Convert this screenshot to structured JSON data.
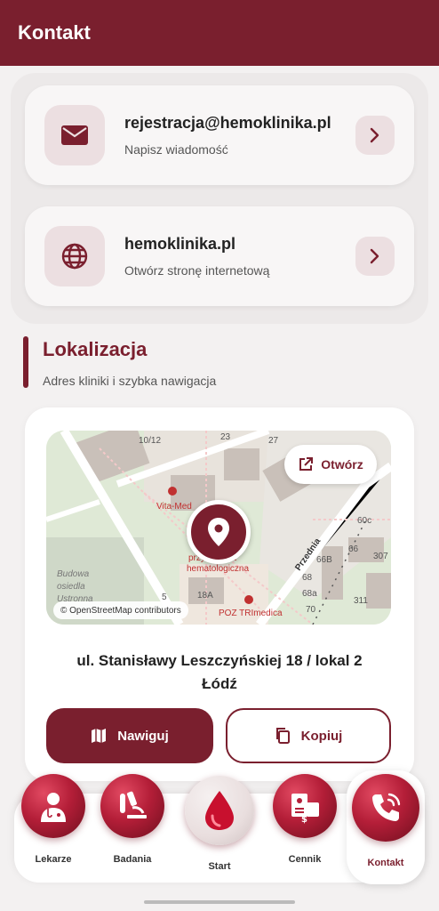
{
  "appbar": {
    "title": "Kontakt"
  },
  "contacts": [
    {
      "title": "rejestracja@hemoklinika.pl",
      "subtitle": "Napisz wiadomość",
      "icon": "mail-icon"
    },
    {
      "title": "hemoklinika.pl",
      "subtitle": "Otwórz stronę internetową",
      "icon": "globe-icon"
    }
  ],
  "section": {
    "title": "Lokalizacja",
    "subtitle": "Adres kliniki i szybka nawigacja"
  },
  "map": {
    "open_label": "Otwórz",
    "attribution": "© OpenStreetMap contributors",
    "labels": {
      "l1": "10/12",
      "l2": "23",
      "l3": "27",
      "vita": "Vita-Med",
      "przych1": "przychodnia",
      "przych2": "hematologiczna",
      "budowa1": "Budowa",
      "budowa2": "osiedla",
      "budowa3": "Ustronna",
      "l18a": "18A",
      "poz": "POZ TRImedica",
      "przednia": "Przednia",
      "l60c": "60c",
      "l66": "66",
      "l66b": "66B",
      "l68": "68",
      "l68a": "68a",
      "l70": "70",
      "l307": "307",
      "l311": "311",
      "l5": "5"
    }
  },
  "address": {
    "line1": "ul. Stanisławy Leszczyńskiej 18 / lokal 2",
    "line2": "Łódź"
  },
  "buttons": {
    "navigate": "Nawiguj",
    "copy": "Kopiuj"
  },
  "nav": [
    {
      "label": "Lekarze",
      "icon": "doctor-icon"
    },
    {
      "label": "Badania",
      "icon": "microscope-icon"
    },
    {
      "label": "Start",
      "icon": "blood-drop-icon"
    },
    {
      "label": "Cennik",
      "icon": "price-list-icon"
    },
    {
      "label": "Kontakt",
      "icon": "phone-icon",
      "active": true
    }
  ],
  "colors": {
    "primary": "#7a1f2e",
    "background": "#f3f1f1",
    "tint": "#ecdfe1"
  }
}
